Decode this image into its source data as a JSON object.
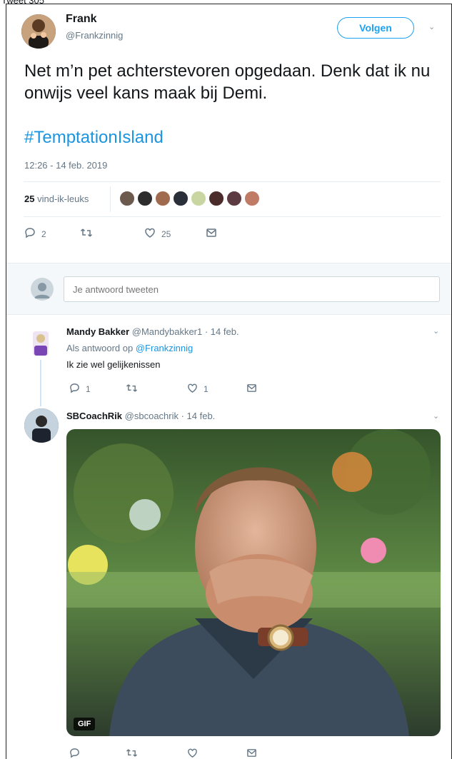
{
  "caption": "Tweet 305",
  "main_tweet": {
    "author": "Frank",
    "handle": "@Frankzinnig",
    "follow_label": "Volgen",
    "text": "Net m’n pet achterstevoren opgedaan. Denk dat ik nu onwijs veel kans maak bij Demi.",
    "hashtag": "#TemptationIsland",
    "timestamp": "12:26 - 14 feb. 2019",
    "likes_count": "25",
    "likes_label": "vind-ik-leuks",
    "actions": {
      "replies": "2",
      "retweets": "",
      "likes": "25"
    }
  },
  "reply_box": {
    "placeholder": "Je antwoord tweeten"
  },
  "replies": [
    {
      "name": "Mandy Bakker",
      "meta": "@Mandybakker1 · 14 feb.",
      "reply_to_prefix": "Als antwoord op",
      "reply_to": "@Frankzinnig",
      "text": "Ik zie wel gelijkenissen",
      "replies": "1",
      "likes": "1"
    },
    {
      "name": "SBCoachRik",
      "meta": "@sbcoachrik · 14 feb.",
      "gif_label": "GIF"
    }
  ],
  "colors": {
    "accent": "#1da1f2",
    "link": "#1b95e0",
    "muted": "#657786"
  },
  "icons": [
    "chevron-down-icon",
    "reply-icon",
    "retweet-icon",
    "like-icon",
    "message-icon",
    "avatar-icon"
  ]
}
